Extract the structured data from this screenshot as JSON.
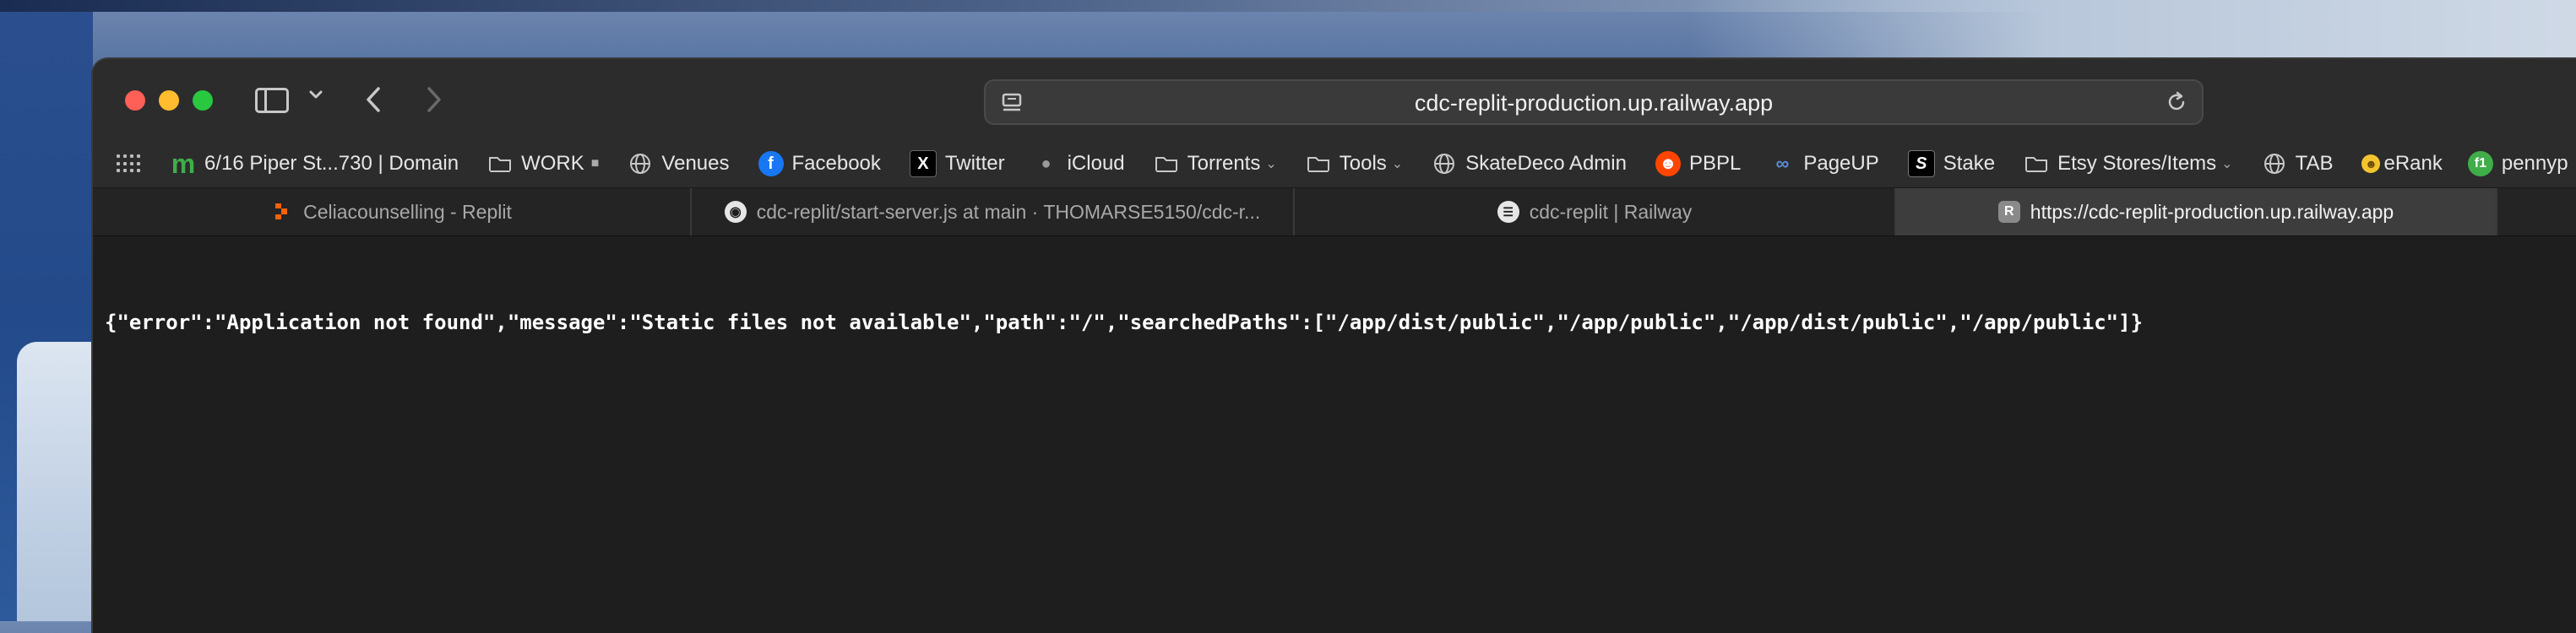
{
  "browser": {
    "address_bar": {
      "url": "cdc-replit-production.up.railway.app"
    },
    "bookmarks": [
      {
        "label": "6/16 Piper St...730 | Domain",
        "icon": "domain-m-icon",
        "color": "#3fae49"
      },
      {
        "label": "WORK",
        "icon": "folder-icon",
        "suffix": "■"
      },
      {
        "label": "Venues",
        "icon": "globe-icon"
      },
      {
        "label": "Facebook",
        "icon": "facebook-icon",
        "color": "#1877f2"
      },
      {
        "label": "Twitter",
        "icon": "x-twitter-icon"
      },
      {
        "label": "iCloud",
        "icon": "apple-icon"
      },
      {
        "label": "Torrents",
        "icon": "folder-icon",
        "dropdown": true
      },
      {
        "label": "Tools",
        "icon": "folder-icon",
        "dropdown": true
      },
      {
        "label": "SkateDeco Admin",
        "icon": "globe-icon"
      },
      {
        "label": "PBPL",
        "icon": "reddit-icon",
        "color": "#ff4500"
      },
      {
        "label": "PageUP",
        "icon": "pageup-icon"
      },
      {
        "label": "Stake",
        "icon": "stake-icon"
      },
      {
        "label": "Etsy Stores/Items",
        "icon": "folder-icon",
        "dropdown": true
      },
      {
        "label": "TAB",
        "icon": "globe-icon"
      },
      {
        "label": "eRank",
        "icon": "emoji-icon"
      },
      {
        "label": "pennyp",
        "icon": "f1-icon",
        "color": "#3fae49"
      }
    ],
    "tabs": [
      {
        "label": "Celiacounselling - Replit",
        "icon": "replit-icon",
        "active": false
      },
      {
        "label": "cdc-replit/start-server.js at main · THOMARSE5150/cdc-r...",
        "icon": "github-icon",
        "active": false
      },
      {
        "label": "cdc-replit | Railway",
        "icon": "railway-icon",
        "active": false
      },
      {
        "label": "https://cdc-replit-production.up.railway.app",
        "icon": "r-letter-icon",
        "active": true
      }
    ]
  },
  "page": {
    "body_text": "{\"error\":\"Application not found\",\"message\":\"Static files not available\",\"path\":\"/\",\"searchedPaths\":[\"/app/dist/public\",\"/app/public\",\"/app/dist/public\",\"/app/public\"]}"
  }
}
